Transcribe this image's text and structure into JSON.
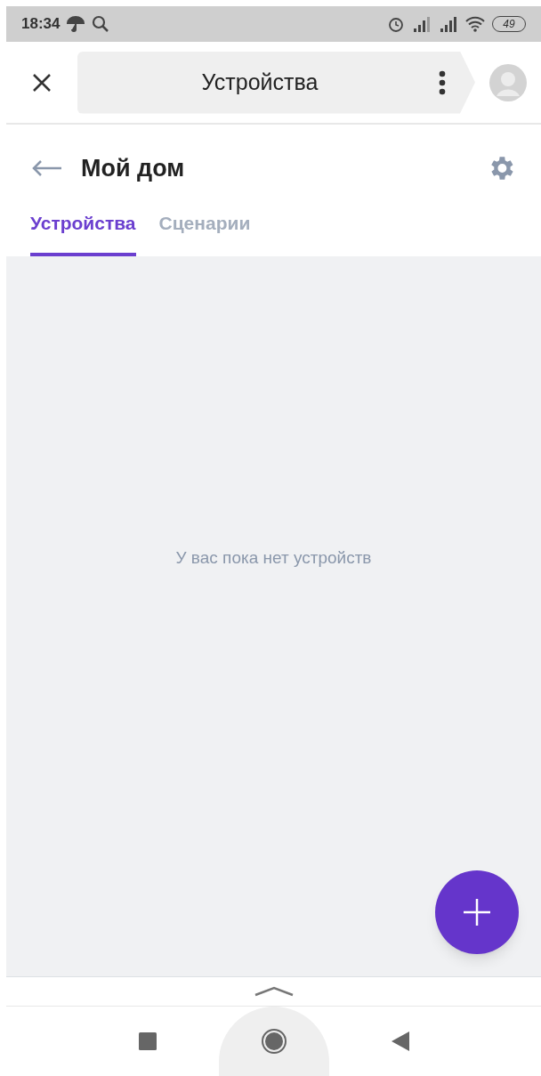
{
  "status_bar": {
    "time": "18:34",
    "battery": "49"
  },
  "top_bar": {
    "title": "Устройства"
  },
  "header": {
    "title": "Мой дом"
  },
  "tabs": [
    {
      "label": "Устройства",
      "selected": true
    },
    {
      "label": "Сценарии",
      "selected": false
    }
  ],
  "empty_message": "У вас пока нет устройств"
}
